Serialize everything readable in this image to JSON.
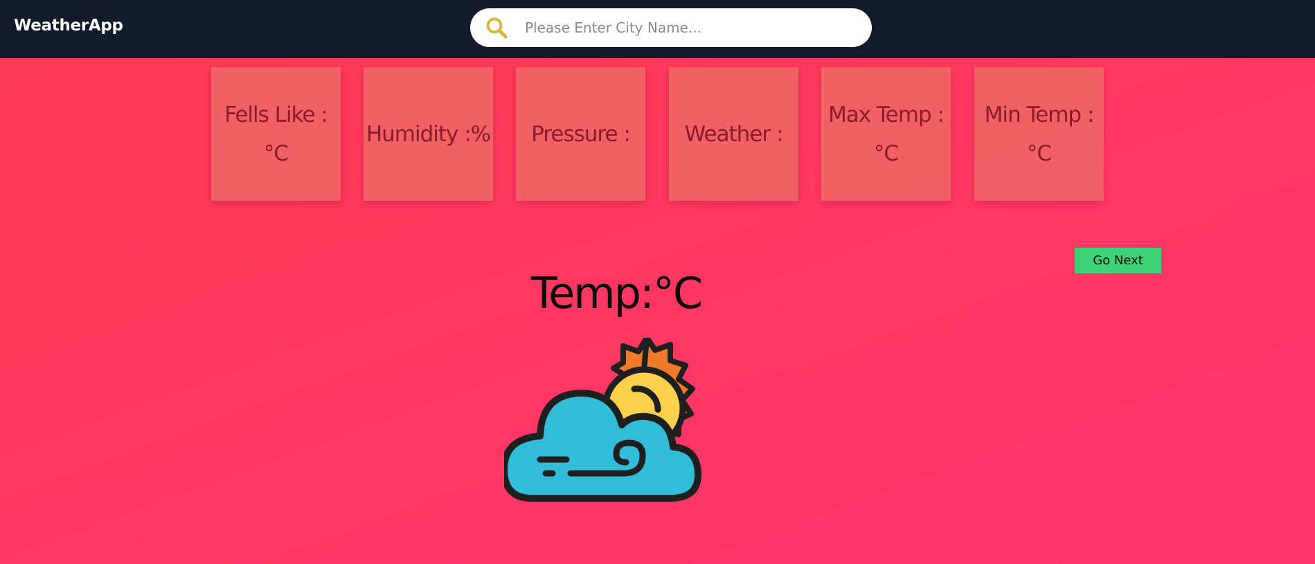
{
  "app": {
    "title": "WeatherApp"
  },
  "search": {
    "placeholder": "Please Enter City Name...",
    "value": ""
  },
  "cards": [
    {
      "label": "Fells Like :",
      "unit": "°C"
    },
    {
      "label": "Humidity :%",
      "unit": ""
    },
    {
      "label": "Pressure :",
      "unit": ""
    },
    {
      "label": "Weather :",
      "unit": ""
    },
    {
      "label": "Max Temp :",
      "unit": "°C"
    },
    {
      "label": "Min Temp :",
      "unit": "°C"
    }
  ],
  "actions": {
    "go_next_label": "Go Next"
  },
  "main": {
    "temp_text": "Temp:°C",
    "weather_icon": "cloudy-wind-sun-icon"
  },
  "colors": {
    "navbar": "#121a2b",
    "background": "#fe3763",
    "card": "#f06464",
    "button": "#3ed276",
    "search_icon": "#d8b73a"
  }
}
